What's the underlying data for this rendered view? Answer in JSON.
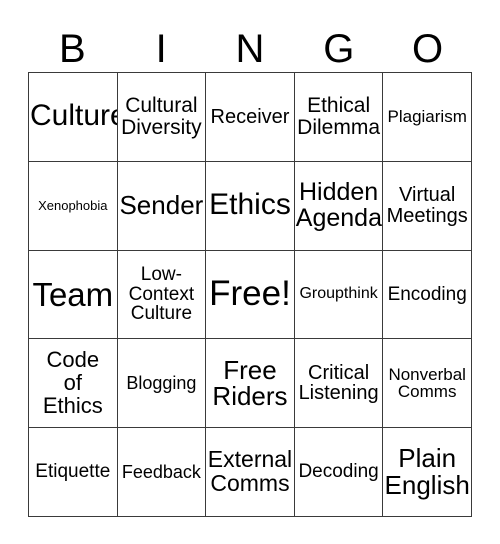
{
  "card": {
    "header_letters": [
      "B",
      "I",
      "N",
      "G",
      "O"
    ],
    "grid_columns": 5,
    "grid_rows": 5,
    "border_color": "#3a3a3a",
    "cell_background": "#ffffff",
    "text_color": "#000000",
    "free_space_label": "Free!",
    "cells": [
      {
        "row": 1,
        "col": 1,
        "text": "Culture",
        "font_px": 30,
        "lines": 1,
        "free_space": false
      },
      {
        "row": 1,
        "col": 2,
        "text": "Cultural\nDiversity",
        "font_px": 21,
        "lines": 2,
        "free_space": false
      },
      {
        "row": 1,
        "col": 3,
        "text": "Receiver",
        "font_px": 20,
        "lines": 1,
        "free_space": false
      },
      {
        "row": 1,
        "col": 4,
        "text": "Ethical\nDilemma",
        "font_px": 21,
        "lines": 2,
        "free_space": false
      },
      {
        "row": 1,
        "col": 5,
        "text": "Plagiarism",
        "font_px": 17,
        "lines": 1,
        "free_space": false
      },
      {
        "row": 2,
        "col": 1,
        "text": "Xenophobia",
        "font_px": 13,
        "lines": 1,
        "free_space": false
      },
      {
        "row": 2,
        "col": 2,
        "text": "Sender",
        "font_px": 26,
        "lines": 1,
        "free_space": false
      },
      {
        "row": 2,
        "col": 3,
        "text": "Ethics",
        "font_px": 30,
        "lines": 1,
        "free_space": false
      },
      {
        "row": 2,
        "col": 4,
        "text": "Hidden\nAgenda",
        "font_px": 25,
        "lines": 2,
        "free_space": false
      },
      {
        "row": 2,
        "col": 5,
        "text": "Virtual\nMeetings",
        "font_px": 20,
        "lines": 2,
        "free_space": false
      },
      {
        "row": 3,
        "col": 1,
        "text": "Team",
        "font_px": 33,
        "lines": 1,
        "free_space": false
      },
      {
        "row": 3,
        "col": 2,
        "text": "Low-\nContext\nCulture",
        "font_px": 19,
        "lines": 3,
        "free_space": false
      },
      {
        "row": 3,
        "col": 3,
        "text": "Free!",
        "font_px": 35,
        "lines": 1,
        "free_space": true
      },
      {
        "row": 3,
        "col": 4,
        "text": "Groupthink",
        "font_px": 16,
        "lines": 1,
        "free_space": false
      },
      {
        "row": 3,
        "col": 5,
        "text": "Encoding",
        "font_px": 19,
        "lines": 1,
        "free_space": false
      },
      {
        "row": 4,
        "col": 1,
        "text": "Code\nof\nEthics",
        "font_px": 22,
        "lines": 3,
        "free_space": false
      },
      {
        "row": 4,
        "col": 2,
        "text": "Blogging",
        "font_px": 18,
        "lines": 1,
        "free_space": false
      },
      {
        "row": 4,
        "col": 3,
        "text": "Free\nRiders",
        "font_px": 26,
        "lines": 2,
        "free_space": false
      },
      {
        "row": 4,
        "col": 4,
        "text": "Critical\nListening",
        "font_px": 20,
        "lines": 2,
        "free_space": false
      },
      {
        "row": 4,
        "col": 5,
        "text": "Nonverbal\nComms",
        "font_px": 17,
        "lines": 2,
        "free_space": false
      },
      {
        "row": 5,
        "col": 1,
        "text": "Etiquette",
        "font_px": 19,
        "lines": 1,
        "free_space": false
      },
      {
        "row": 5,
        "col": 2,
        "text": "Feedback",
        "font_px": 18,
        "lines": 1,
        "free_space": false
      },
      {
        "row": 5,
        "col": 3,
        "text": "External\nComms",
        "font_px": 23,
        "lines": 2,
        "free_space": false
      },
      {
        "row": 5,
        "col": 4,
        "text": "Decoding",
        "font_px": 19,
        "lines": 1,
        "free_space": false
      },
      {
        "row": 5,
        "col": 5,
        "text": "Plain\nEnglish",
        "font_px": 26,
        "lines": 2,
        "free_space": false
      }
    ]
  }
}
